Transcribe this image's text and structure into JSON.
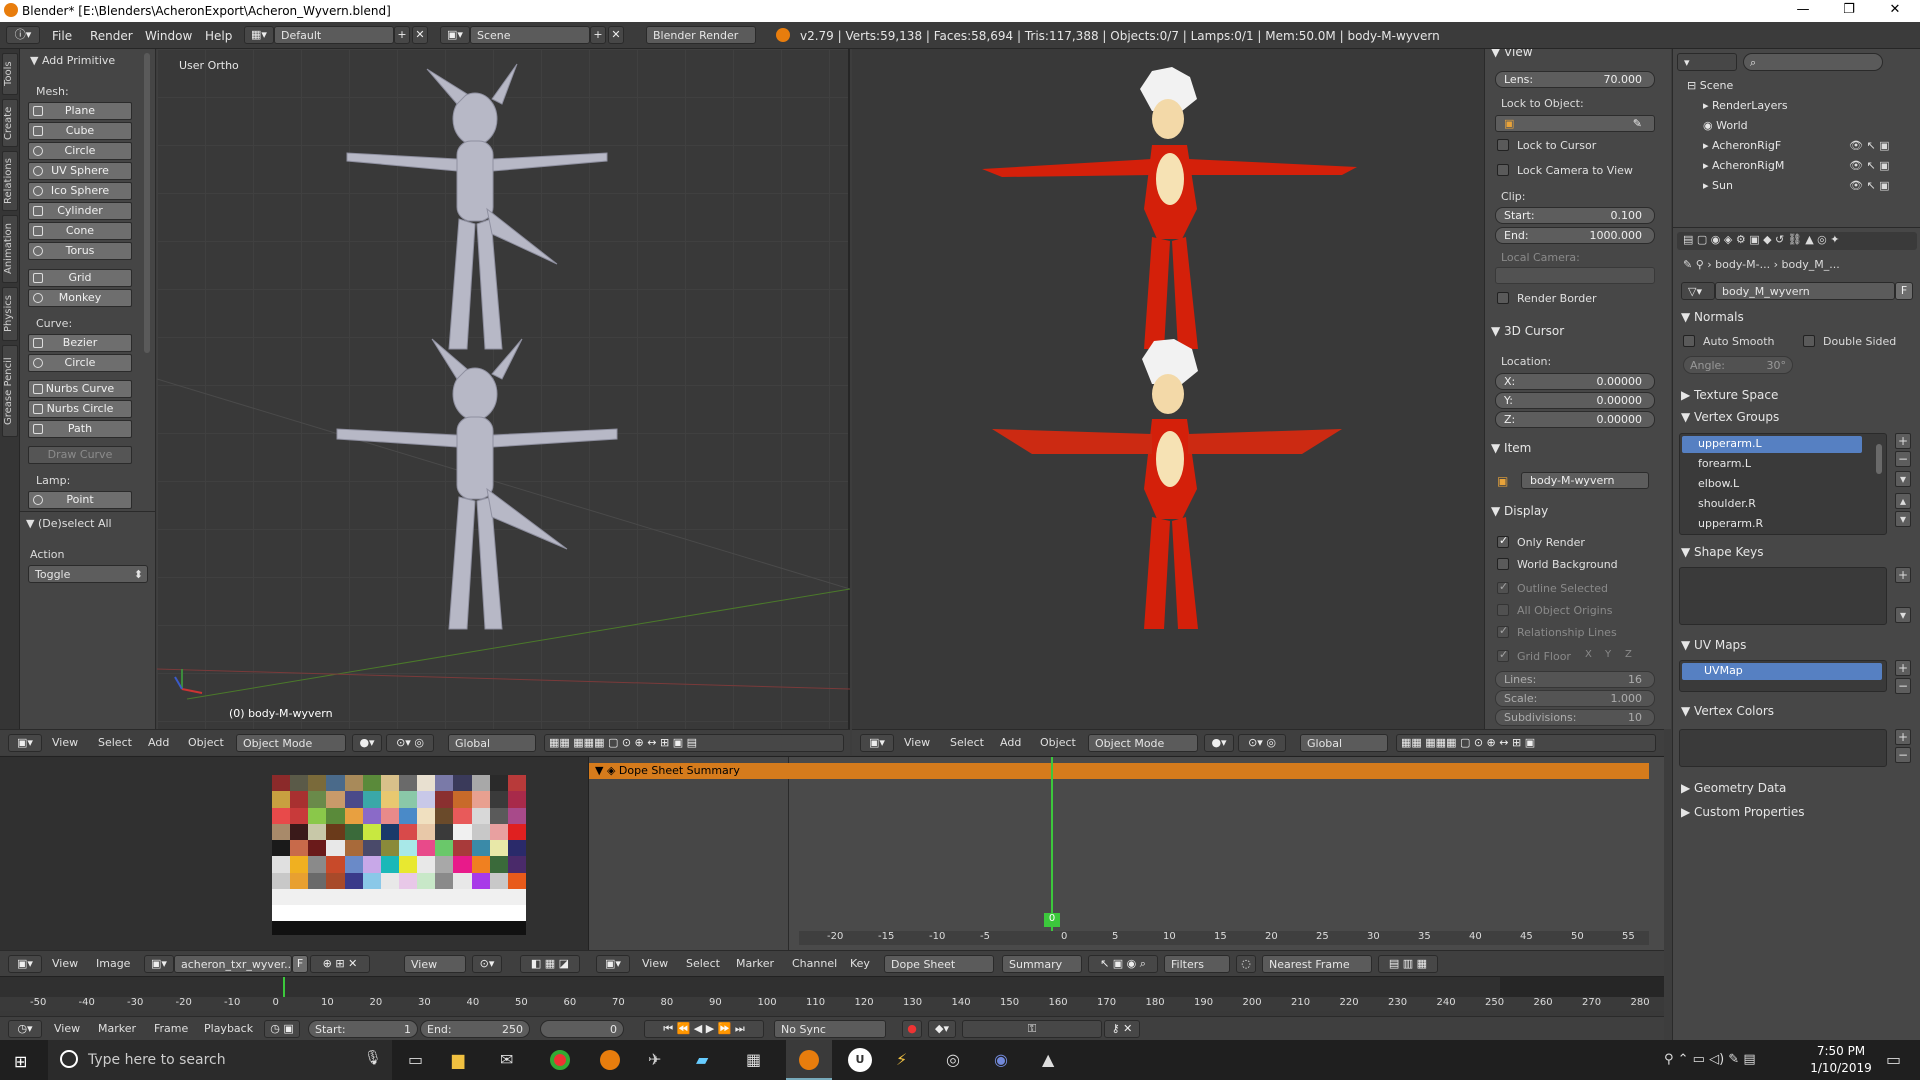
{
  "window": {
    "title": "Blender* [E:\\Blenders\\AcheronExport\\Acheron_Wyvern.blend]"
  },
  "info_header": {
    "menus": [
      "File",
      "Render",
      "Window",
      "Help"
    ],
    "layout": "Default",
    "scene": "Scene",
    "engine": "Blender Render",
    "stats": "v2.79 | Verts:59,138 | Faces:58,694 | Tris:117,388 | Objects:0/7 | Lamps:0/1 | Mem:50.0M | body-M-wyvern"
  },
  "shelf_tabs": [
    "Tools",
    "Create",
    "Relations",
    "Animation",
    "Physics",
    "Grease Pencil"
  ],
  "tool_shelf": {
    "panel_title": "Add Primitive",
    "mesh_label": "Mesh:",
    "mesh": [
      "Plane",
      "Cube",
      "Circle",
      "UV Sphere",
      "Ico Sphere",
      "Cylinder",
      "Cone",
      "Torus"
    ],
    "mesh2": [
      "Grid",
      "Monkey"
    ],
    "curve_label": "Curve:",
    "curve": [
      "Bezier",
      "Circle"
    ],
    "nurbs": [
      "Nurbs Curve",
      "Nurbs Circle",
      "Path"
    ],
    "draw_curve": "Draw Curve",
    "lamp_label": "Lamp:",
    "lamp": [
      "Point"
    ],
    "operator_title": "(De)select All",
    "action_label": "Action",
    "action_value": "Toggle"
  },
  "viewport_left": {
    "label": "User Ortho",
    "object_label": "(0) body-M-wyvern"
  },
  "viewport_header": {
    "menus": [
      "View",
      "Select",
      "Add",
      "Object"
    ],
    "mode": "Object Mode",
    "orientation": "Global"
  },
  "npanel": {
    "view_title": "View",
    "lens_label": "Lens:",
    "lens": "70.000",
    "lock_object_label": "Lock to Object:",
    "lock_cursor": "Lock to Cursor",
    "lock_camera": "Lock Camera to View",
    "clip_label": "Clip:",
    "clip_start_label": "Start:",
    "clip_start": "0.100",
    "clip_end_label": "End:",
    "clip_end": "1000.000",
    "local_camera": "Local Camera:",
    "render_border": "Render Border",
    "cursor_title": "3D Cursor",
    "location_label": "Location:",
    "x_label": "X:",
    "x": "0.00000",
    "y_label": "Y:",
    "y": "0.00000",
    "z_label": "Z:",
    "z": "0.00000",
    "item_title": "Item",
    "item_name": "body-M-wyvern",
    "display_title": "Display",
    "only_render": "Only Render",
    "world_bg": "World Background",
    "outline_sel": "Outline Selected",
    "all_origins": "All Object Origins",
    "rel_lines": "Relationship Lines",
    "grid_floor": "Grid Floor",
    "axes": [
      "X",
      "Y",
      "Z"
    ],
    "lines_label": "Lines:",
    "lines": "16",
    "scale_label": "Scale:",
    "scale": "1.000",
    "subdiv_label": "Subdivisions:",
    "subdiv": "10"
  },
  "outliner": {
    "items": [
      "Scene",
      "RenderLayers",
      "World",
      "AcheronRigF",
      "AcheronRigM",
      "Sun"
    ]
  },
  "properties": {
    "breadcrumb": [
      "body-M-...",
      "body_M_..."
    ],
    "mesh_name": "body_M_wyvern",
    "fake_user": "F",
    "normals_title": "Normals",
    "auto_smooth": "Auto Smooth",
    "double_sided": "Double Sided",
    "angle_label": "Angle:",
    "angle": "30°",
    "texture_space": "Texture Space",
    "vertex_groups_title": "Vertex Groups",
    "vertex_groups": [
      "upperarm.L",
      "forearm.L",
      "elbow.L",
      "shoulder.R",
      "upperarm.R"
    ],
    "shape_keys_title": "Shape Keys",
    "uv_maps_title": "UV Maps",
    "uv_maps": [
      "UVMap"
    ],
    "vertex_colors_title": "Vertex Colors",
    "geometry_data": "Geometry Data",
    "custom_props": "Custom Properties"
  },
  "image_editor": {
    "menus": [
      "View",
      "Image"
    ],
    "image_name": "acheron_txr_wyver...",
    "fake": "F",
    "view_mode": "View"
  },
  "dopesheet": {
    "summary": "Dope Sheet Summary",
    "menus": [
      "View",
      "Select",
      "Marker",
      "Channel",
      "Key"
    ],
    "mode": "Dope Sheet",
    "summary_btn": "Summary",
    "filters": "Filters",
    "snap": "Nearest Frame",
    "ticks": [
      "-20",
      "-15",
      "-10",
      "-5",
      "0",
      "5",
      "10",
      "15",
      "20",
      "25",
      "30",
      "35",
      "40",
      "45",
      "50",
      "55"
    ],
    "current_frame": "0"
  },
  "timeline": {
    "ticks": [
      "-50",
      "-40",
      "-30",
      "-20",
      "-10",
      "0",
      "10",
      "20",
      "30",
      "40",
      "50",
      "60",
      "70",
      "80",
      "90",
      "100",
      "110",
      "120",
      "130",
      "140",
      "150",
      "160",
      "170",
      "180",
      "190",
      "200",
      "210",
      "220",
      "230",
      "240",
      "250",
      "260",
      "270",
      "280"
    ],
    "menus": [
      "View",
      "Marker",
      "Frame",
      "Playback"
    ],
    "start_label": "Start:",
    "start": "1",
    "end_label": "End:",
    "end": "250",
    "current": "0",
    "sync": "No Sync"
  },
  "taskbar": {
    "search_placeholder": "Type here to search",
    "time": "7:50 PM",
    "date": "1/10/2019"
  },
  "colors": {
    "accent": "#e87d0d",
    "selected": "#5680c2",
    "wyvern_red": "#d4200a"
  }
}
